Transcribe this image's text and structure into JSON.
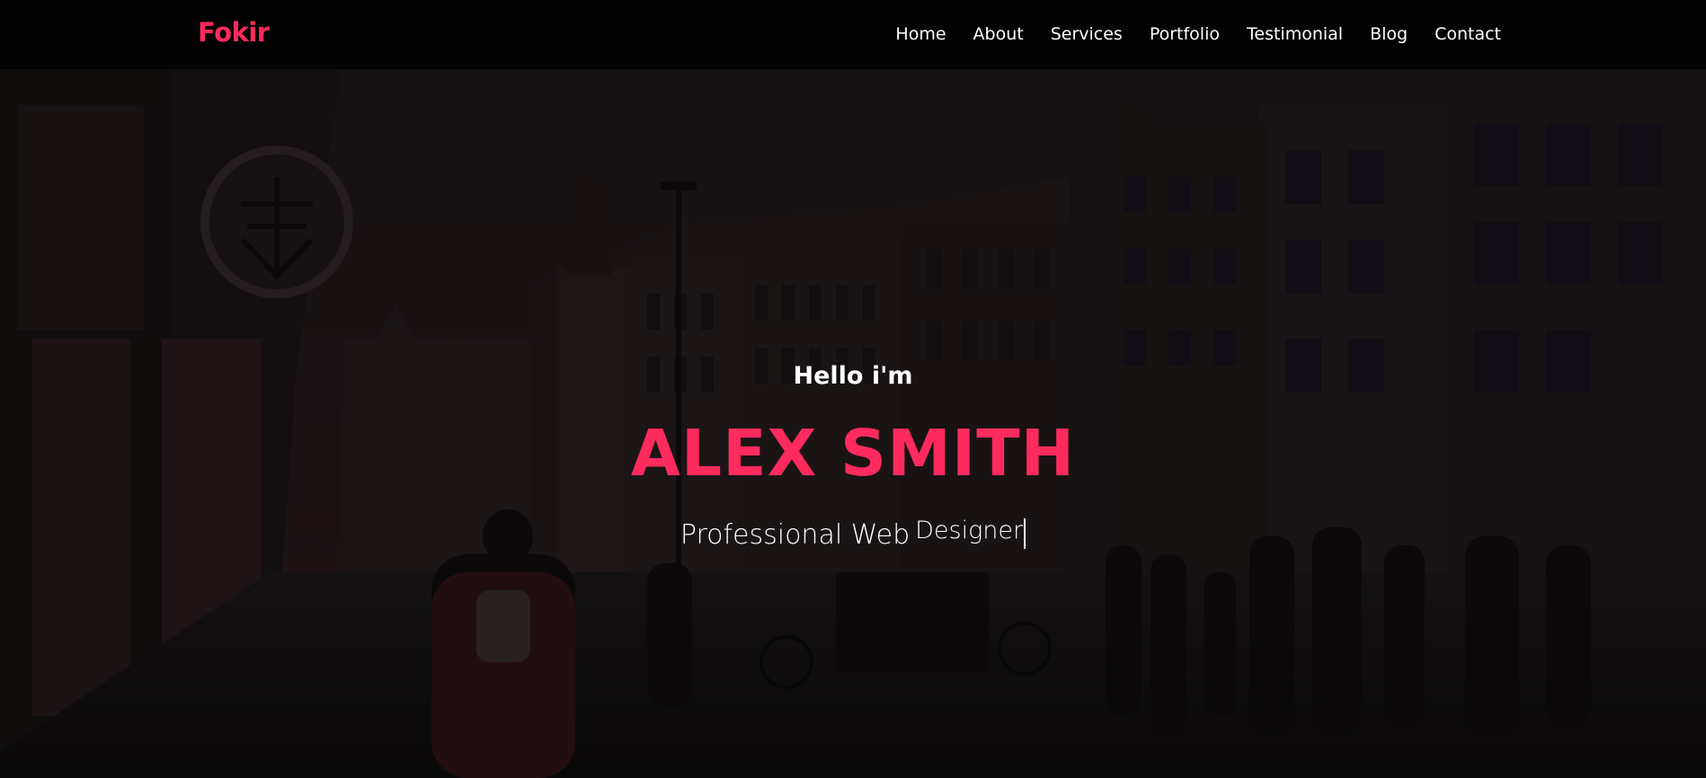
{
  "brand": {
    "name": "Fokir",
    "accent_color": "#ff2b5e"
  },
  "nav": {
    "items": [
      {
        "label": "Home"
      },
      {
        "label": "About"
      },
      {
        "label": "Services"
      },
      {
        "label": "Portfolio"
      },
      {
        "label": "Testimonial"
      },
      {
        "label": "Blog"
      },
      {
        "label": "Contact"
      }
    ]
  },
  "hero": {
    "greeting": "Hello i'm",
    "name": "ALEX SMITH",
    "profession_prefix": "Professional Web",
    "profession_typed": "Designer",
    "background": "dark city street at dusk"
  }
}
